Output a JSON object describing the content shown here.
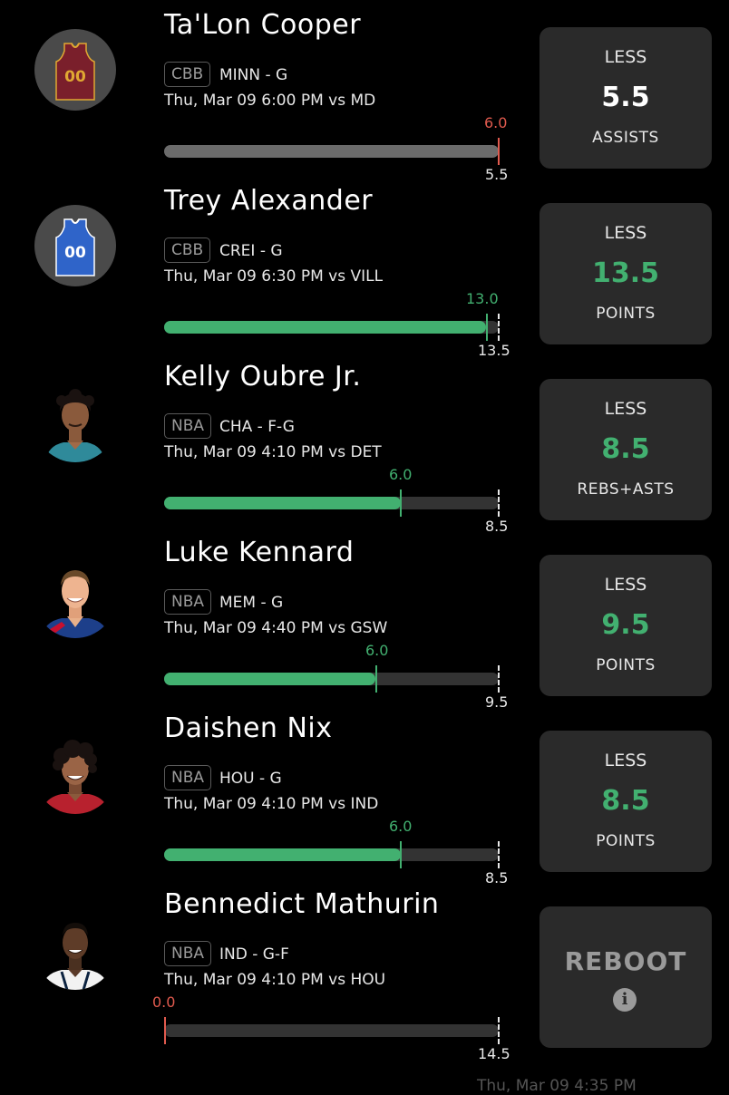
{
  "colors": {
    "green": "#42b070",
    "red": "#e05a4e",
    "white": "#ffffff",
    "card": "#2a2a2a"
  },
  "players": [
    {
      "name": "Ta'Lon Cooper",
      "league": "CBB",
      "team_pos": "MINN - G",
      "time": "Thu, Mar 09 6:00 PM  vs MD",
      "avatar": "jersey-maroon-icon",
      "actual": "6.0",
      "line": "5.5",
      "progress": 1.0,
      "status": "over",
      "pick": "LESS",
      "value": "5.5",
      "stat": "ASSISTS"
    },
    {
      "name": "Trey Alexander",
      "league": "CBB",
      "team_pos": "CREI - G",
      "time": "Thu, Mar 09 6:30 PM  vs VILL",
      "avatar": "jersey-blue-icon",
      "actual": "13.0",
      "line": "13.5",
      "progress": 0.963,
      "status": "under",
      "pick": "LESS",
      "value": "13.5",
      "stat": "POINTS"
    },
    {
      "name": "Kelly Oubre Jr.",
      "league": "NBA",
      "team_pos": "CHA - F-G",
      "time": "Thu, Mar 09 4:10 PM  vs DET",
      "avatar": "player-headshot-icon",
      "actual": "6.0",
      "line": "8.5",
      "progress": 0.706,
      "status": "under",
      "pick": "LESS",
      "value": "8.5",
      "stat": "REBS+ASTS"
    },
    {
      "name": "Luke Kennard",
      "league": "NBA",
      "team_pos": "MEM - G",
      "time": "Thu, Mar 09 4:40 PM  vs GSW",
      "avatar": "player-headshot-icon",
      "actual": "6.0",
      "line": "9.5",
      "progress": 0.632,
      "status": "under",
      "pick": "LESS",
      "value": "9.5",
      "stat": "POINTS"
    },
    {
      "name": "Daishen Nix",
      "league": "NBA",
      "team_pos": "HOU - G",
      "time": "Thu, Mar 09 4:10 PM  vs IND",
      "avatar": "player-headshot-icon",
      "actual": "6.0",
      "line": "8.5",
      "progress": 0.706,
      "status": "under",
      "pick": "LESS",
      "value": "8.5",
      "stat": "POINTS"
    },
    {
      "name": "Bennedict Mathurin",
      "league": "NBA",
      "team_pos": "IND - G-F",
      "time": "Thu, Mar 09 4:10 PM  vs HOU",
      "avatar": "player-headshot-icon",
      "actual": "0.0",
      "line": "14.5",
      "progress": 0.0,
      "status": "reboot",
      "reboot_label": "REBOOT",
      "info_glyph": "i"
    }
  ],
  "footer": {
    "text": "Thu, Mar 09 4:35 PM"
  }
}
